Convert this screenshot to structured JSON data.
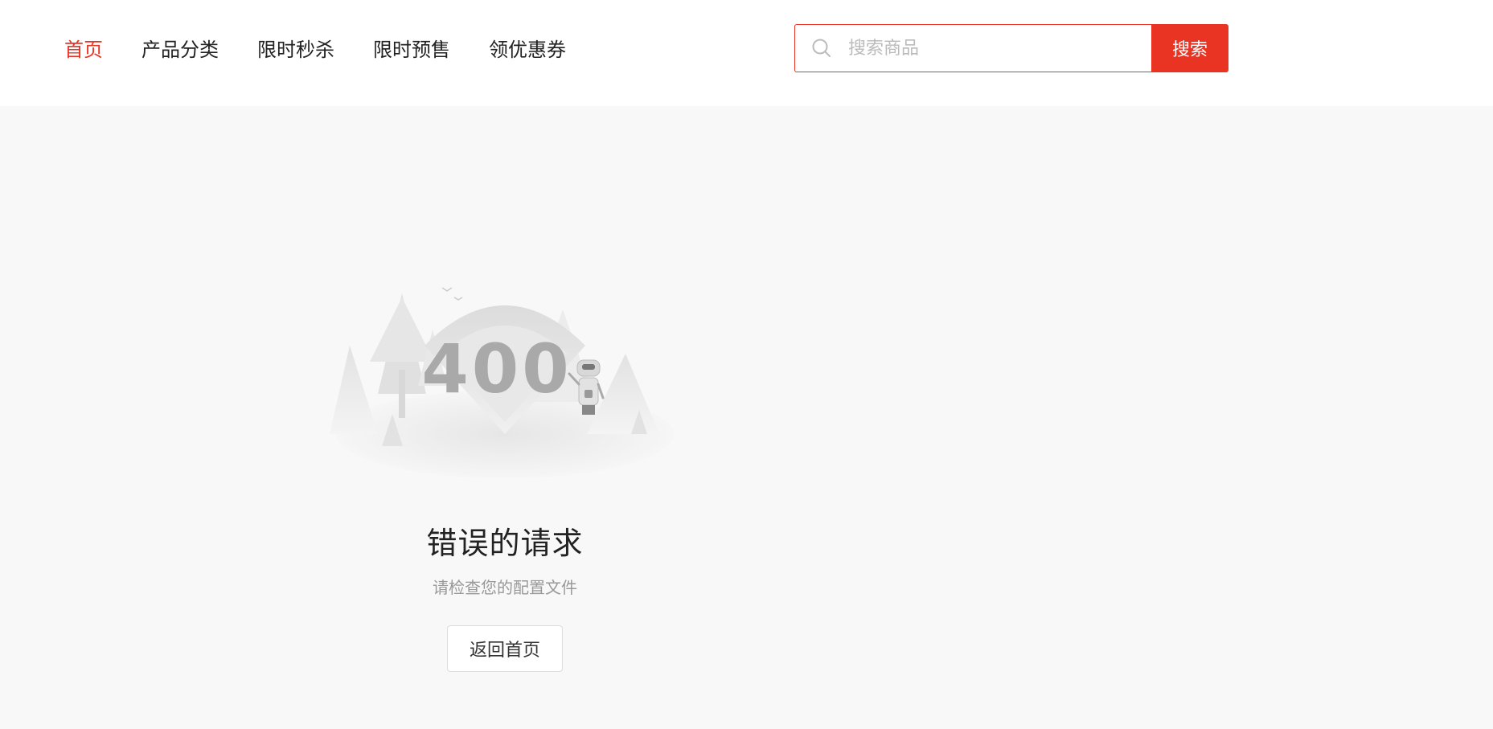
{
  "nav": {
    "items": [
      {
        "label": "首页",
        "active": true
      },
      {
        "label": "产品分类",
        "active": false
      },
      {
        "label": "限时秒杀",
        "active": false
      },
      {
        "label": "限时预售",
        "active": false
      },
      {
        "label": "领优惠券",
        "active": false
      }
    ]
  },
  "search": {
    "placeholder": "搜索商品",
    "value": "",
    "button_label": "搜索",
    "icon": "search-icon"
  },
  "error": {
    "code": "400",
    "title": "错误的请求",
    "subtitle": "请检查您的配置文件",
    "back_label": "返回首页"
  },
  "colors": {
    "accent": "#e93323",
    "page_bg": "#f8f8f8",
    "header_bg": "#ffffff"
  }
}
